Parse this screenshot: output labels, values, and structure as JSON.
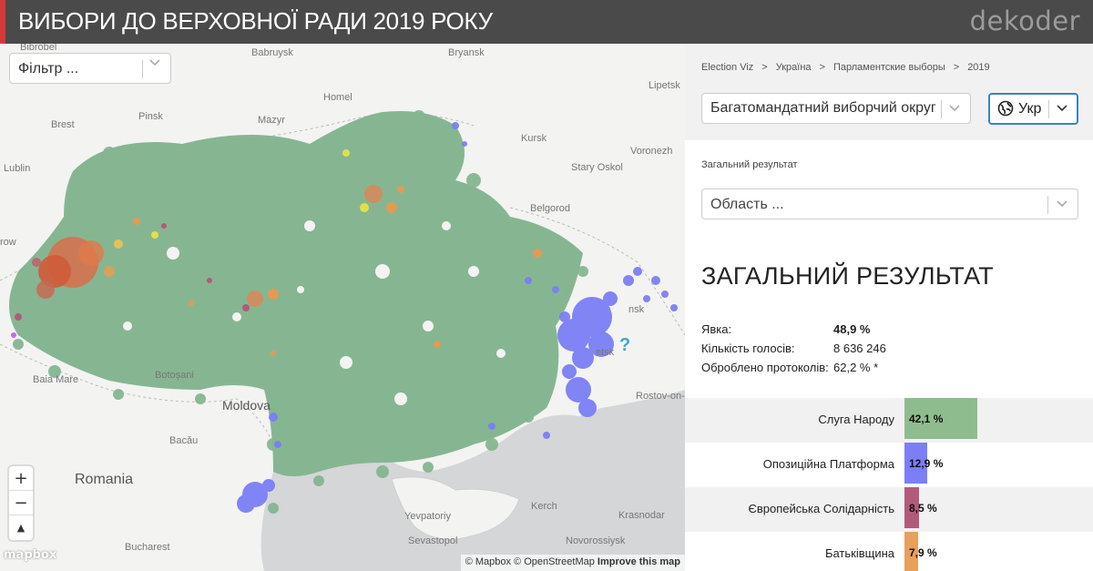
{
  "header": {
    "title": "ВИБОРИ ДО ВЕРХОВНОЇ РАДИ 2019 РОКУ",
    "logo": "dekoder",
    "accent_color": "#d6393b"
  },
  "map": {
    "filter_placeholder": "Фільтр ...",
    "zoom_in": "+",
    "zoom_out": "−",
    "compass": "▲",
    "help": "?",
    "mapbox_logo": "mapbox",
    "attribution_1": "© Mapbox © OpenStreetMap",
    "attribution_2": "Improve this map",
    "labels": {
      "bryansk": "Bryansk",
      "babruysk": "Babruysk",
      "homel": "Homel",
      "pinsk": "Pinsk",
      "mazyr": "Mazyr",
      "brest": "Brest",
      "lublin": "Lublin",
      "kursk": "Kursk",
      "lipetsk": "Lipetsk",
      "voronezh": "Voronezh",
      "stary_oskol": "Stary Oskol",
      "belgorod": "Belgorod",
      "baia_mare": "Baia Mare",
      "botosani": "Botoșani",
      "moldova": "Moldova",
      "bacau": "Bacău",
      "romania": "Romania",
      "bucharest": "Bucharest",
      "rostov": "Rostov-on-D",
      "kerch": "Kerch",
      "yevpatoriy": "Yevpatoriy",
      "sevastopol": "Sevastopol",
      "novorossiysk": "Novorossiysk",
      "krasnodar": "Krasnodar",
      "bibrobel": "Bibrobel",
      "row": "row",
      "msk": "nsk",
      "etsk": "etsk"
    }
  },
  "panel": {
    "breadcrumb": [
      "Election Viz",
      "Україна",
      "Парламентские выборы",
      "2019"
    ],
    "district_select": "Багатомандатний виборчий округ",
    "language": "Укр",
    "section_label": "Загальний результат",
    "region_placeholder": "Область ...",
    "result_heading": "ЗАГАЛЬНИЙ РЕЗУЛЬТАТ",
    "stats": {
      "turnout_label": "Явка:",
      "turnout_value": "48,9 %",
      "votes_label": "Кількість голосів:",
      "votes_value": "8 636 246",
      "protocols_label": "Оброблено протоколів:",
      "protocols_value": "62,2 % *"
    },
    "results": [
      {
        "name": "Слуга Народу",
        "value": "42,1 %",
        "share": 42.1,
        "color": "#8fbc8f"
      },
      {
        "name": "Опозиційна Платформа",
        "value": "12,9 %",
        "share": 12.9,
        "color": "#7b7ff5"
      },
      {
        "name": "Європейська Солідарність",
        "value": "8,5 %",
        "share": 8.5,
        "color": "#b35a7a"
      },
      {
        "name": "Батьківщина",
        "value": "7,9 %",
        "share": 7.9,
        "color": "#e8a05a"
      }
    ]
  }
}
